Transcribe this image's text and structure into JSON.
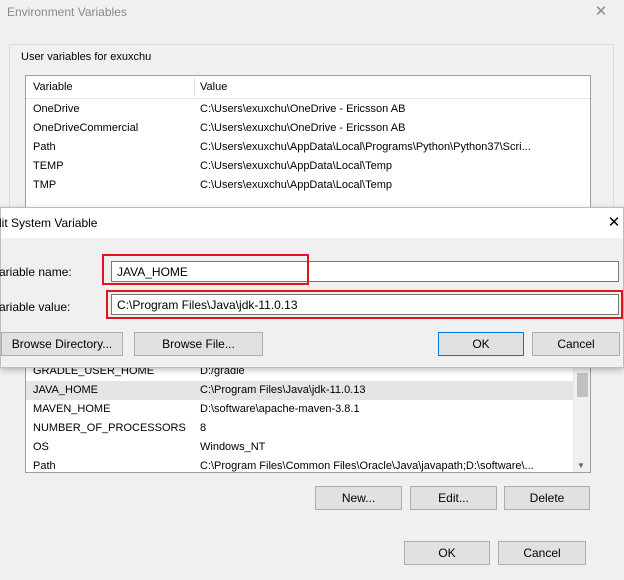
{
  "env_window": {
    "title": "Environment Variables",
    "close_glyph": "✕",
    "user_group_label": "User variables for exuxchu",
    "columns": {
      "variable": "Variable",
      "value": "Value"
    },
    "user_vars": [
      {
        "name": "OneDrive",
        "value": "C:\\Users\\exuxchu\\OneDrive - Ericsson AB"
      },
      {
        "name": "OneDriveCommercial",
        "value": "C:\\Users\\exuxchu\\OneDrive - Ericsson AB"
      },
      {
        "name": "Path",
        "value": "C:\\Users\\exuxchu\\AppData\\Local\\Programs\\Python\\Python37\\Scri..."
      },
      {
        "name": "TEMP",
        "value": "C:\\Users\\exuxchu\\AppData\\Local\\Temp"
      },
      {
        "name": "TMP",
        "value": "C:\\Users\\exuxchu\\AppData\\Local\\Temp"
      }
    ],
    "system_vars": [
      {
        "name": "GRADLE_USER_HOME",
        "value": "D:/gradle"
      },
      {
        "name": "JAVA_HOME",
        "value": "C:\\Program Files\\Java\\jdk-11.0.13"
      },
      {
        "name": "MAVEN_HOME",
        "value": "D:\\software\\apache-maven-3.8.1"
      },
      {
        "name": "NUMBER_OF_PROCESSORS",
        "value": "8"
      },
      {
        "name": "OS",
        "value": "Windows_NT"
      },
      {
        "name": "Path",
        "value": "C:\\Program Files\\Common Files\\Oracle\\Java\\javapath;D:\\software\\..."
      }
    ],
    "system_buttons": {
      "new": "New...",
      "edit": "Edit...",
      "delete": "Delete"
    },
    "footer_buttons": {
      "ok": "OK",
      "cancel": "Cancel"
    }
  },
  "edit_dialog": {
    "title": "lit System Variable",
    "close_glyph": "✕",
    "name_label": "ariable name:",
    "value_label": "ariable value:",
    "name_value": "JAVA_HOME",
    "value_value": "C:\\Program Files\\Java\\jdk-11.0.13",
    "buttons": {
      "browse_directory": "Browse Directory...",
      "browse_file": "Browse File...",
      "ok": "OK",
      "cancel": "Cancel"
    }
  },
  "colors": {
    "highlight": "#e0141e",
    "window_bg": "#f0f0f0",
    "selected_row": "#e5e5e5"
  }
}
